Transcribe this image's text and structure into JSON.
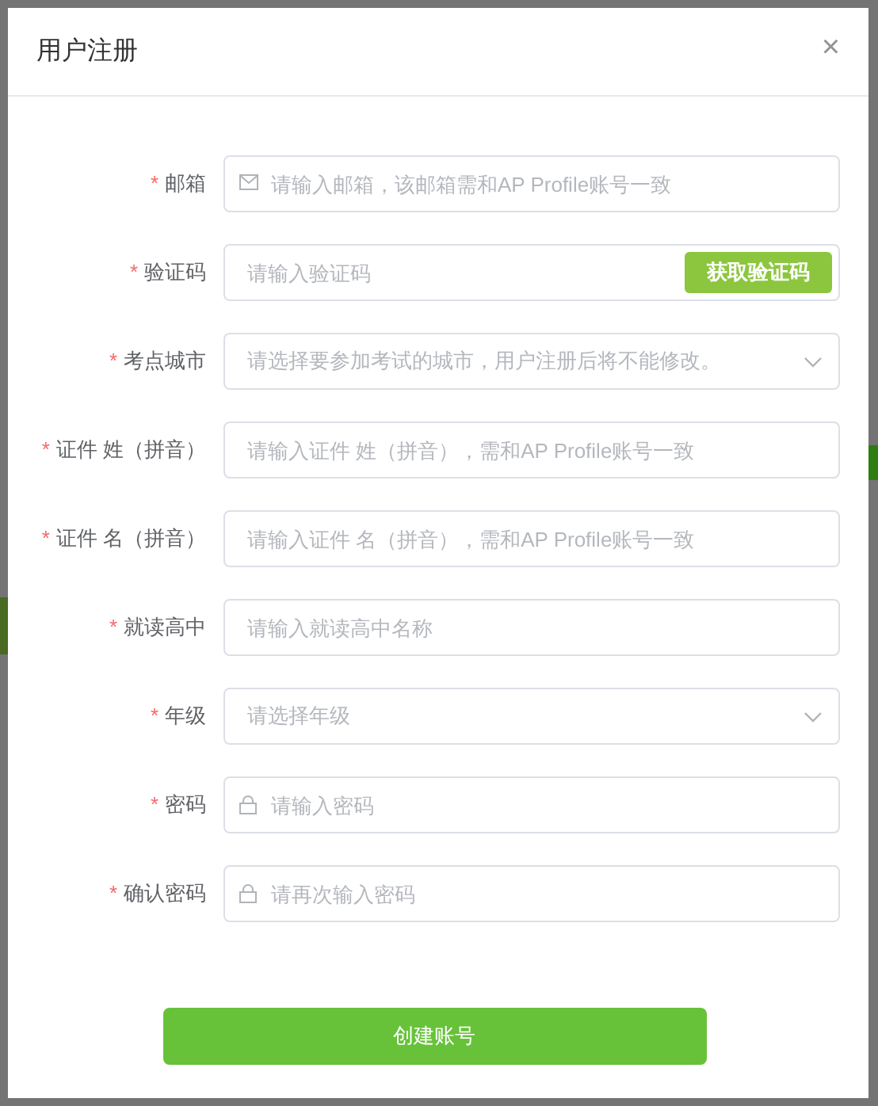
{
  "dialog": {
    "title": "用户注册",
    "close": "×"
  },
  "required_mark": "*",
  "fields": [
    {
      "kind": "email",
      "required": true,
      "label": "邮箱",
      "placeholder": "请输入邮箱，该邮箱需和AP Profile账号一致"
    },
    {
      "kind": "code",
      "required": true,
      "label": "验证码",
      "placeholder": "请输入验证码",
      "button": "获取验证码"
    },
    {
      "kind": "select",
      "required": true,
      "label": "考点城市",
      "placeholder": "请选择要参加考试的城市，用户注册后将不能修改。"
    },
    {
      "kind": "text",
      "required": true,
      "label": "证件 姓（拼音）",
      "placeholder": "请输入证件 姓（拼音），需和AP Profile账号一致"
    },
    {
      "kind": "text",
      "required": true,
      "label": "证件 名（拼音）",
      "placeholder": "请输入证件 名（拼音），需和AP Profile账号一致"
    },
    {
      "kind": "text",
      "required": true,
      "label": "就读高中",
      "placeholder": "请输入就读高中名称"
    },
    {
      "kind": "select",
      "required": true,
      "label": "年级",
      "placeholder": "请选择年级"
    },
    {
      "kind": "password",
      "required": true,
      "label": "密码",
      "placeholder": "请输入密码"
    },
    {
      "kind": "password",
      "required": true,
      "label": "确认密码",
      "placeholder": "请再次输入密码"
    }
  ],
  "submit": "创建账号"
}
